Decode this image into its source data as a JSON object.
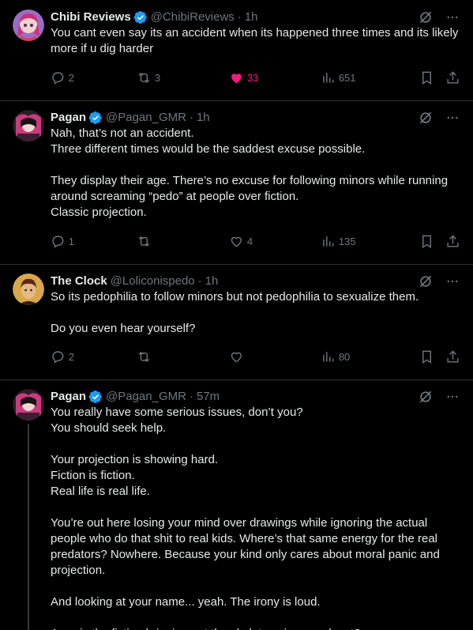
{
  "tweets": [
    {
      "name": "Chibi Reviews",
      "handle": "@ChibiReviews",
      "time": "1h",
      "text": "You cant even say its an accident when its happened three times and its likely more if u dig harder",
      "replies": "2",
      "retweets": "3",
      "likes": "33",
      "views": "651",
      "liked": true,
      "avatar_color": "#8e5bb5"
    },
    {
      "name": "Pagan",
      "handle": "@Pagan_GMR",
      "time": "1h",
      "text": "Nah, that’s not an accident.\nThree different times would be the saddest excuse possible.\n\nThey display their age. There’s no excuse for following minors while running around screaming “pedo” at people over fiction.\nClassic projection.",
      "replies": "1",
      "retweets": "",
      "likes": "4",
      "views": "135",
      "liked": false,
      "avatar_color": "#3a2a35"
    },
    {
      "name": "The Clock",
      "handle": "@Loliconispedo",
      "time": "1h",
      "text": "So its pedophilia to follow minors but not pedophilia to sexualize them.\n\nDo you even hear yourself?",
      "replies": "2",
      "retweets": "",
      "likes": "",
      "views": "80",
      "liked": false,
      "avatar_color": "#b0823e"
    },
    {
      "name": "Pagan",
      "handle": "@Pagan_GMR",
      "time": "57m",
      "text": "You really have some serious issues, don’t you?\nYou should seek help.\n\nYour projection is showing hard.\nFiction is fiction.\nReal life is real life.\n\nYou’re out here losing your mind over drawings while ignoring the actual people who do that shit to real kids. Where’s that same energy for the real predators? Nowhere. Because your kind only cares about moral panic and projection.\n\nAnd looking at your name... yeah. The irony is loud.\n\nAwe, is the fiction bringing out the skeletons in your closet?",
      "avatar_color": "#3a2a35"
    }
  ],
  "colors": {
    "background": "#000000",
    "text": "#e7e9ea",
    "muted": "#71767b",
    "verified": "#1d9bf0",
    "like": "#f91880",
    "border": "#2f3336"
  },
  "icons": {
    "reply": "reply-icon",
    "retweet": "retweet-icon",
    "like": "heart-icon",
    "views": "views-icon",
    "bookmark": "bookmark-icon",
    "share": "share-icon",
    "grok": "grok-icon",
    "more": "more-icon",
    "verified": "verified-badge-icon"
  }
}
